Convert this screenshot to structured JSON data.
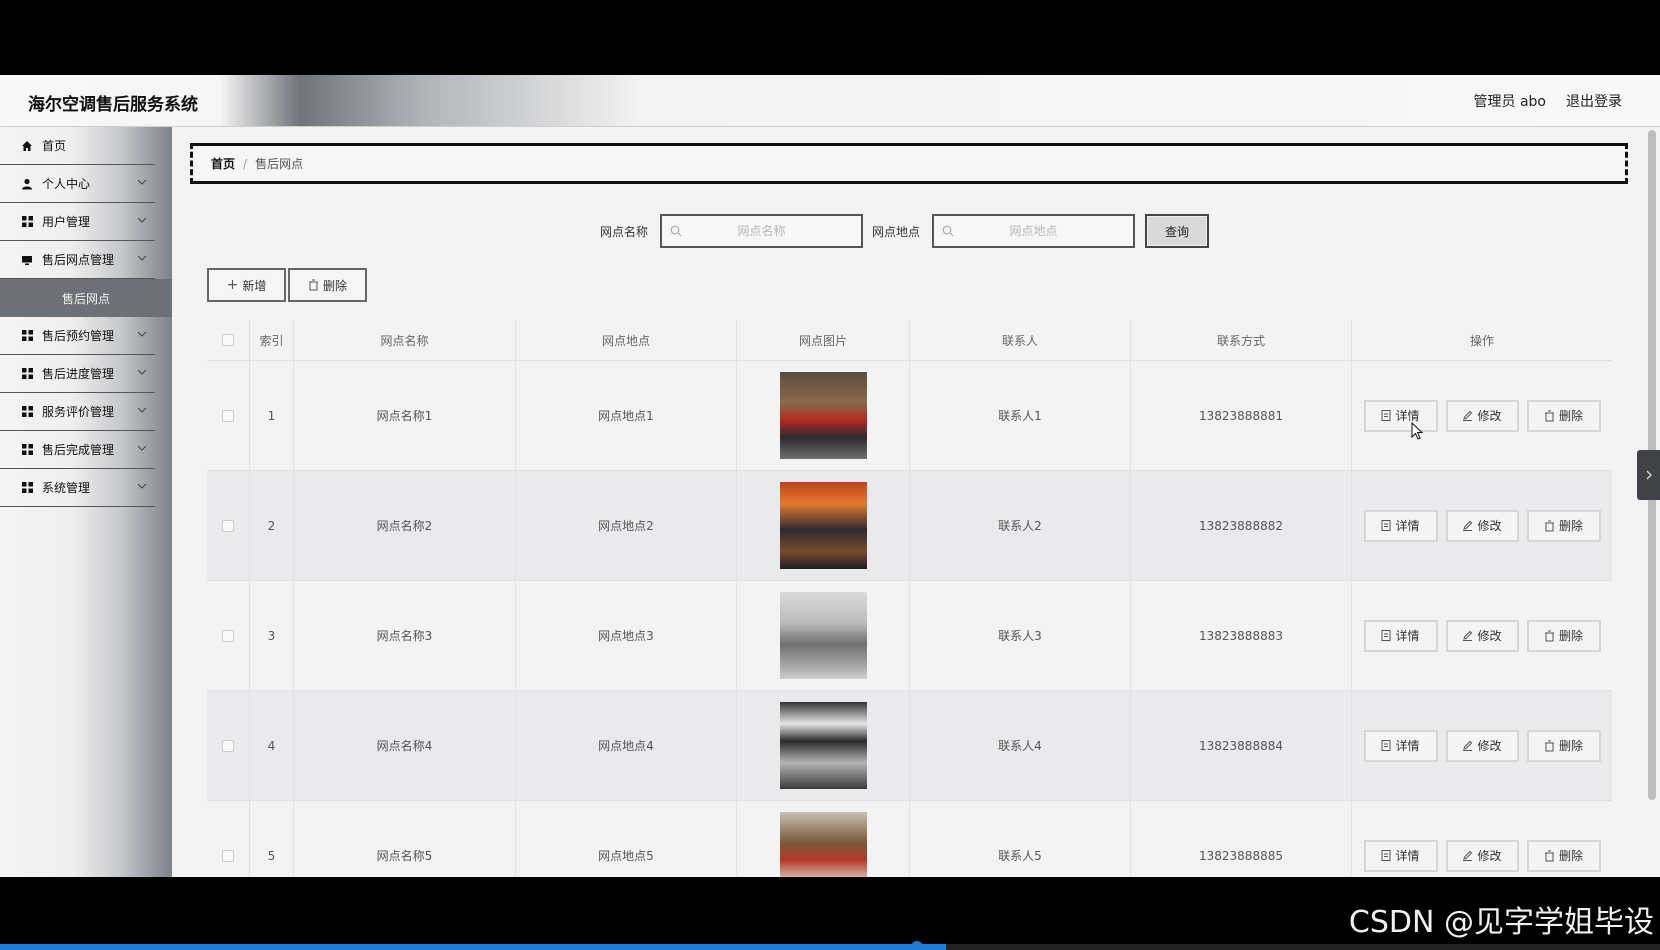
{
  "header": {
    "title": "海尔空调售后服务系统",
    "user": "管理员 abo",
    "logout": "退出登录"
  },
  "sidebar": {
    "items": [
      {
        "label": "首页",
        "icon": "home-icon"
      },
      {
        "label": "个人中心",
        "icon": "user-icon"
      },
      {
        "label": "用户管理",
        "icon": "grid-icon"
      },
      {
        "label": "售后网点管理",
        "icon": "monitor-icon"
      },
      {
        "label": "售后预约管理",
        "icon": "grid-icon"
      },
      {
        "label": "售后进度管理",
        "icon": "grid-icon"
      },
      {
        "label": "服务评价管理",
        "icon": "grid-icon"
      },
      {
        "label": "售后完成管理",
        "icon": "grid-icon"
      },
      {
        "label": "系统管理",
        "icon": "grid-icon"
      }
    ],
    "active_sub": "售后网点"
  },
  "breadcrumb": {
    "home": "首页",
    "current": "售后网点"
  },
  "search": {
    "name_label": "网点名称",
    "name_placeholder": "网点名称",
    "location_label": "网点地点",
    "location_placeholder": "网点地点",
    "query": "查询"
  },
  "toolbar": {
    "add": "新增",
    "delete": "删除"
  },
  "table": {
    "columns": [
      "索引",
      "网点名称",
      "网点地点",
      "网点图片",
      "联系人",
      "联系方式",
      "操作"
    ],
    "actions": {
      "detail": "详情",
      "edit": "修改",
      "delete": "删除"
    },
    "rows": [
      {
        "index": "1",
        "name": "网点名称1",
        "location": "网点地点1",
        "contact": "联系人1",
        "phone": "13823888881"
      },
      {
        "index": "2",
        "name": "网点名称2",
        "location": "网点地点2",
        "contact": "联系人2",
        "phone": "13823888882"
      },
      {
        "index": "3",
        "name": "网点名称3",
        "location": "网点地点3",
        "contact": "联系人3",
        "phone": "13823888883"
      },
      {
        "index": "4",
        "name": "网点名称4",
        "location": "网点地点4",
        "contact": "联系人4",
        "phone": "13823888884"
      },
      {
        "index": "5",
        "name": "网点名称5",
        "location": "网点地点5",
        "contact": "联系人5",
        "phone": "13823888885"
      }
    ]
  },
  "watermark": "CSDN @见字学姐毕设",
  "video_progress": 0.57
}
